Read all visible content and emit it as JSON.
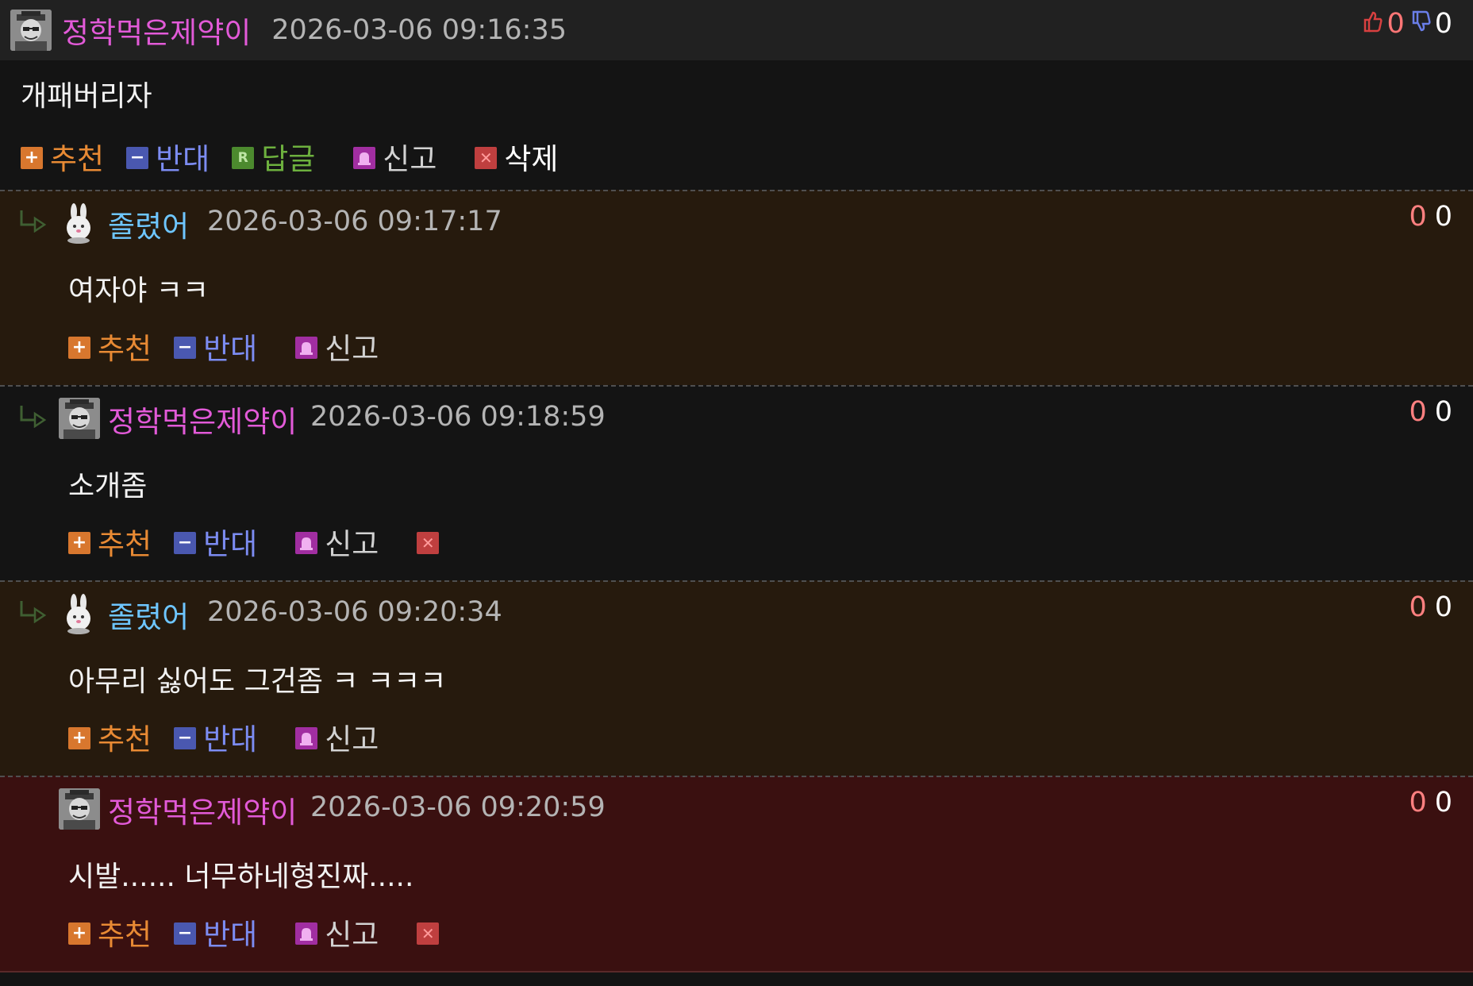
{
  "colors": {
    "nick_member": "#e25ad8",
    "nick_guest": "#6ec6ff",
    "bg_reply_guest": "#261a0d",
    "bg_reply_member": "#141414",
    "bg_reply_highlight": "#3a1010"
  },
  "main_comment": {
    "nickname": "정학먹은제약이",
    "date": "2026-03-06 09:16:35",
    "up_count": "0",
    "down_count": "0",
    "text": "개패버리자",
    "actions": {
      "recommend": "추천",
      "oppose": "반대",
      "reply": "답글",
      "report": "신고",
      "delete": "삭제"
    }
  },
  "replies": [
    {
      "nickname": "졸렸어",
      "date": "2026-03-06 09:17:17",
      "up_count": "0",
      "down_count": "0",
      "text": "여자야 ㅋㅋ",
      "actions": {
        "recommend": "추천",
        "oppose": "반대",
        "report": "신고"
      }
    },
    {
      "nickname": "정학먹은제약이",
      "date": "2026-03-06 09:18:59",
      "up_count": "0",
      "down_count": "0",
      "text": "소개좀",
      "actions": {
        "recommend": "추천",
        "oppose": "반대",
        "report": "신고"
      }
    },
    {
      "nickname": "졸렸어",
      "date": "2026-03-06 09:20:34",
      "up_count": "0",
      "down_count": "0",
      "text": "아무리 싫어도 그건좀 ㅋ ㅋㅋㅋ",
      "actions": {
        "recommend": "추천",
        "oppose": "반대",
        "report": "신고"
      }
    },
    {
      "nickname": "정학먹은제약이",
      "date": "2026-03-06 09:20:59",
      "up_count": "0",
      "down_count": "0",
      "text": "시발...... 너무하네형진짜.....",
      "actions": {
        "recommend": "추천",
        "oppose": "반대",
        "report": "신고"
      }
    }
  ]
}
